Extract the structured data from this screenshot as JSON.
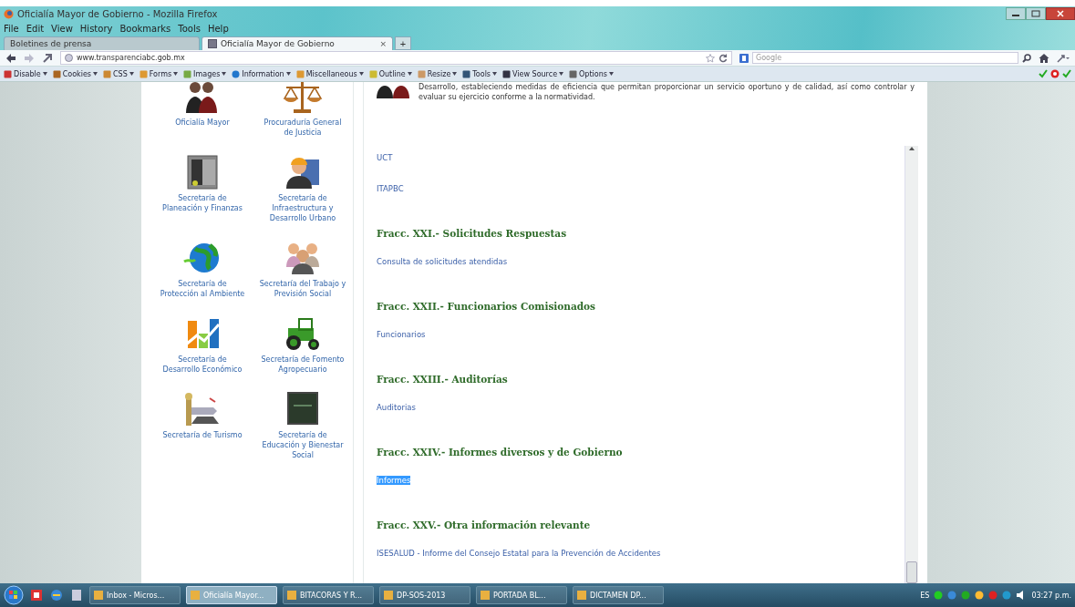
{
  "window": {
    "title": "Oficialía Mayor de Gobierno - Mozilla Firefox"
  },
  "menu": [
    "File",
    "Edit",
    "View",
    "History",
    "Bookmarks",
    "Tools",
    "Help"
  ],
  "tabs": [
    {
      "label": "Boletines de prensa",
      "selected": false
    },
    {
      "label": "Oficialía Mayor de Gobierno",
      "selected": true
    }
  ],
  "tab_close": "×",
  "new_tab": "+",
  "address": {
    "url": "www.transparenciabc.gob.mx"
  },
  "search": {
    "placeholder": "Google"
  },
  "devbar": [
    "Disable",
    "Cookies",
    "CSS",
    "Forms",
    "Images",
    "Information",
    "Miscellaneous",
    "Outline",
    "Resize",
    "Tools",
    "View Source",
    "Options"
  ],
  "sidebar": {
    "items": [
      {
        "label": "Oficialía Mayor"
      },
      {
        "label": "Procuraduría General de Justicia"
      },
      {
        "label": "Secretaría de Planeación y Finanzas"
      },
      {
        "label": "Secretaría de Infraestructura y Desarrollo Urbano"
      },
      {
        "label": "Secretaría de Protección al Ambiente"
      },
      {
        "label": "Secretaría del Trabajo y Previsión Social"
      },
      {
        "label": "Secretaría de Desarrollo Económico"
      },
      {
        "label": "Secretaría de Fomento Agropecuario"
      },
      {
        "label": "Secretaría de Turismo"
      },
      {
        "label": "Secretaría de Educación y Bienestar Social"
      }
    ]
  },
  "main": {
    "intro": "Desarrollo, estableciendo medidas de eficiencia que permitan proporcionar un servicio oportuno y de calidad, así como controlar y evaluar su ejercicio conforme a la normatividad.",
    "items": [
      {
        "kind": "link",
        "text": "UCT",
        "highlighted": false
      },
      {
        "kind": "link",
        "text": "ITAPBC",
        "highlighted": false
      },
      {
        "kind": "heading",
        "text": "Fracc. XXI.- Solicitudes Respuestas"
      },
      {
        "kind": "link",
        "text": "Consulta de solicitudes atendidas",
        "highlighted": false
      },
      {
        "kind": "heading",
        "text": "Fracc. XXII.- Funcionarios Comisionados"
      },
      {
        "kind": "link",
        "text": "Funcionarios",
        "highlighted": false
      },
      {
        "kind": "heading",
        "text": "Fracc. XXIII.- Auditorías"
      },
      {
        "kind": "link",
        "text": "Auditorias",
        "highlighted": false
      },
      {
        "kind": "heading",
        "text": "Fracc. XXIV.- Informes diversos y de Gobierno"
      },
      {
        "kind": "link",
        "text": "Informes",
        "highlighted": true
      },
      {
        "kind": "heading",
        "text": "Fracc. XXV.- Otra información relevante"
      },
      {
        "kind": "link",
        "text": "ISESALUD - Informe del Consejo Estatal para la Prevención de Accidentes",
        "highlighted": false
      }
    ]
  },
  "taskbar": {
    "buttons": [
      {
        "label": "Inbox - Micros...",
        "selected": false
      },
      {
        "label": "Oficialía Mayor...",
        "selected": true
      },
      {
        "label": "BITACORAS Y R...",
        "selected": false
      },
      {
        "label": "DP-SOS-2013",
        "selected": false
      },
      {
        "label": "PORTADA BL...",
        "selected": false
      },
      {
        "label": "DICTAMEN DP...",
        "selected": false
      }
    ],
    "language": "ES",
    "clock": "03:27 p.m."
  }
}
